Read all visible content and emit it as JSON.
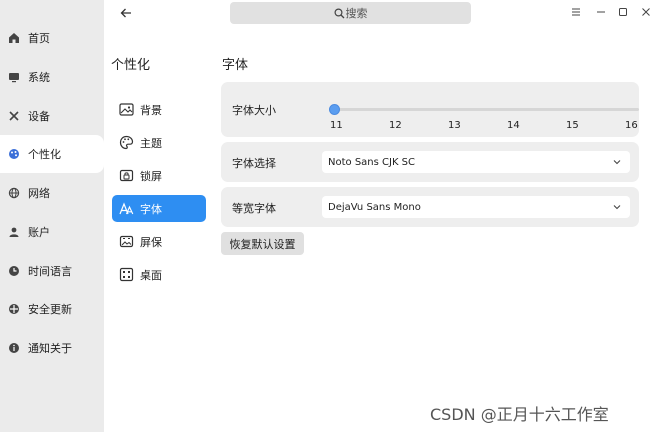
{
  "nav": {
    "items": [
      {
        "label": "首页",
        "icon": "home-icon"
      },
      {
        "label": "系统",
        "icon": "monitor-icon"
      },
      {
        "label": "设备",
        "icon": "tools-icon"
      },
      {
        "label": "个性化",
        "icon": "palette-icon"
      },
      {
        "label": "网络",
        "icon": "globe-icon"
      },
      {
        "label": "账户",
        "icon": "user-icon"
      },
      {
        "label": "时间语言",
        "icon": "clock-icon"
      },
      {
        "label": "安全更新",
        "icon": "shield-icon"
      },
      {
        "label": "通知关于",
        "icon": "info-icon"
      }
    ],
    "active": "个性化"
  },
  "titlebar": {
    "search_placeholder": "搜索"
  },
  "subnav": {
    "title": "个性化",
    "items": [
      {
        "label": "背景",
        "icon": "image-icon"
      },
      {
        "label": "主题",
        "icon": "palette-icon"
      },
      {
        "label": "锁屏",
        "icon": "lockscreen-icon"
      },
      {
        "label": "字体",
        "icon": "font-icon"
      },
      {
        "label": "屏保",
        "icon": "screensaver-icon"
      },
      {
        "label": "桌面",
        "icon": "desktop-icon"
      }
    ],
    "active": "字体"
  },
  "content": {
    "title": "字体",
    "font_size": {
      "label": "字体大小",
      "ticks": [
        "11",
        "12",
        "13",
        "14",
        "15",
        "16"
      ],
      "value": 11,
      "min": 11,
      "max": 16
    },
    "font_select": {
      "label": "字体选择",
      "value": "Noto Sans CJK SC"
    },
    "mono_select": {
      "label": "等宽字体",
      "value": "DejaVu Sans Mono"
    },
    "reset_label": "恢复默认设置"
  },
  "watermark": "CSDN @正月十六工作室",
  "colors": {
    "accent": "#2e8ef2",
    "nav_bg": "#ebebeb",
    "card_bg": "#eeeeee"
  }
}
